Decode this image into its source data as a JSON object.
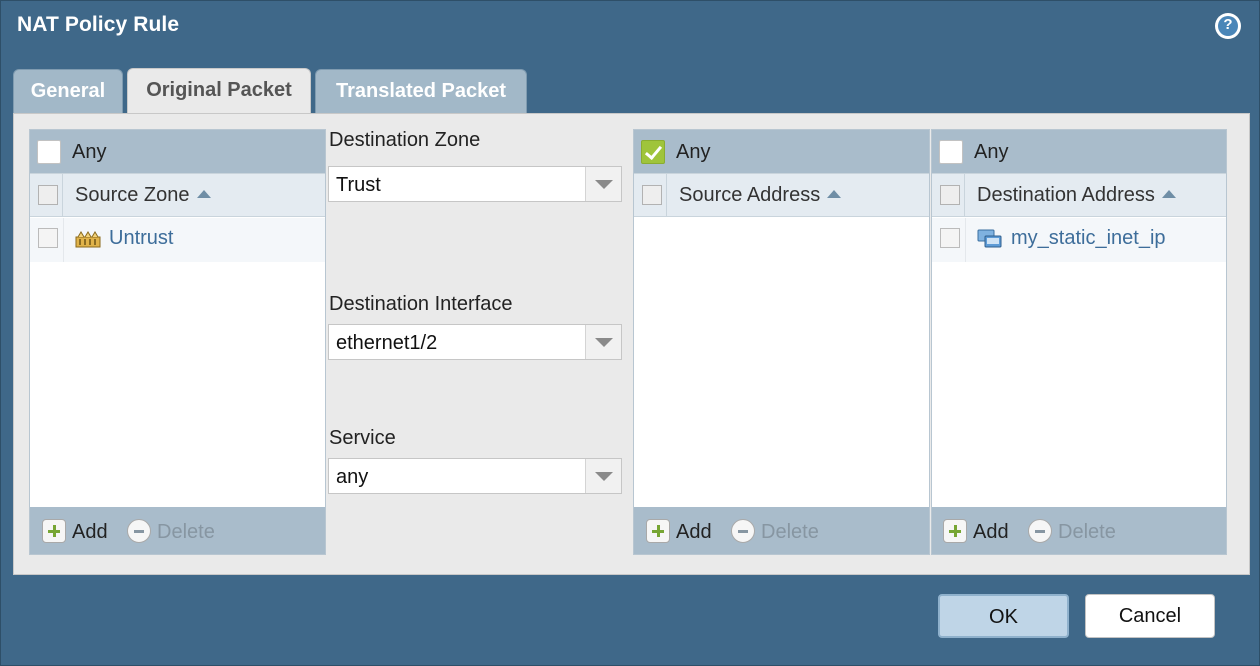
{
  "dialog": {
    "title": "NAT Policy Rule"
  },
  "tabs": [
    {
      "label": "General"
    },
    {
      "label": "Original Packet"
    },
    {
      "label": "Translated Packet"
    }
  ],
  "source_zone": {
    "any_label": "Any",
    "any_checked": false,
    "header": "Source Zone",
    "rows": [
      {
        "value": "Untrust",
        "icon": "zone-icon"
      }
    ],
    "add_label": "Add",
    "delete_label": "Delete"
  },
  "destination_zone": {
    "label": "Destination Zone",
    "value": "Trust"
  },
  "destination_interface": {
    "label": "Destination Interface",
    "value": "ethernet1/2"
  },
  "service": {
    "label": "Service",
    "value": "any"
  },
  "source_address": {
    "any_label": "Any",
    "any_checked": true,
    "header": "Source Address",
    "add_label": "Add",
    "delete_label": "Delete"
  },
  "destination_address": {
    "any_label": "Any",
    "any_checked": false,
    "header": "Destination Address",
    "rows": [
      {
        "value": "my_static_inet_ip",
        "icon": "address-object-icon"
      }
    ],
    "add_label": "Add",
    "delete_label": "Delete"
  },
  "buttons": {
    "ok_label": "OK",
    "cancel_label": "Cancel"
  },
  "colors": {
    "frame": "#3f6889",
    "accent_check": "#9fc43b",
    "link": "#3d6d9a"
  }
}
